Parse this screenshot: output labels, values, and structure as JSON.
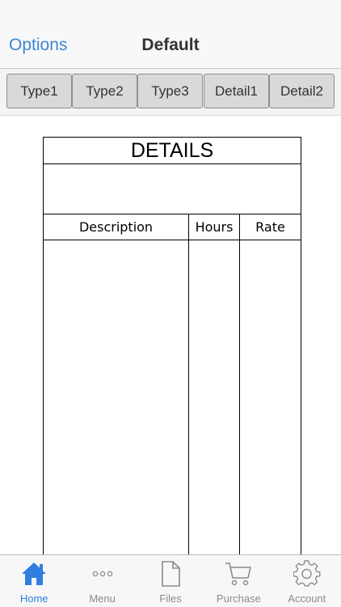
{
  "nav": {
    "left_label": "Options",
    "title": "Default"
  },
  "segments": [
    {
      "label": "Type1"
    },
    {
      "label": "Type2"
    },
    {
      "label": "Type3"
    },
    {
      "label": "Detail1"
    },
    {
      "label": "Detail2"
    }
  ],
  "document": {
    "title": "DETAILS",
    "columns": [
      "Description",
      "Hours",
      "Rate"
    ]
  },
  "tabbar": {
    "items": [
      {
        "label": "Home",
        "icon": "home-icon",
        "active": true
      },
      {
        "label": "Menu",
        "icon": "more-icon",
        "active": false
      },
      {
        "label": "Files",
        "icon": "file-icon",
        "active": false
      },
      {
        "label": "Purchase",
        "icon": "cart-icon",
        "active": false
      },
      {
        "label": "Account",
        "icon": "gear-icon",
        "active": false
      }
    ]
  },
  "colors": {
    "accent": "#3b87d6",
    "tab_active": "#2f7fe0",
    "tab_inactive": "#8a8a8a"
  }
}
